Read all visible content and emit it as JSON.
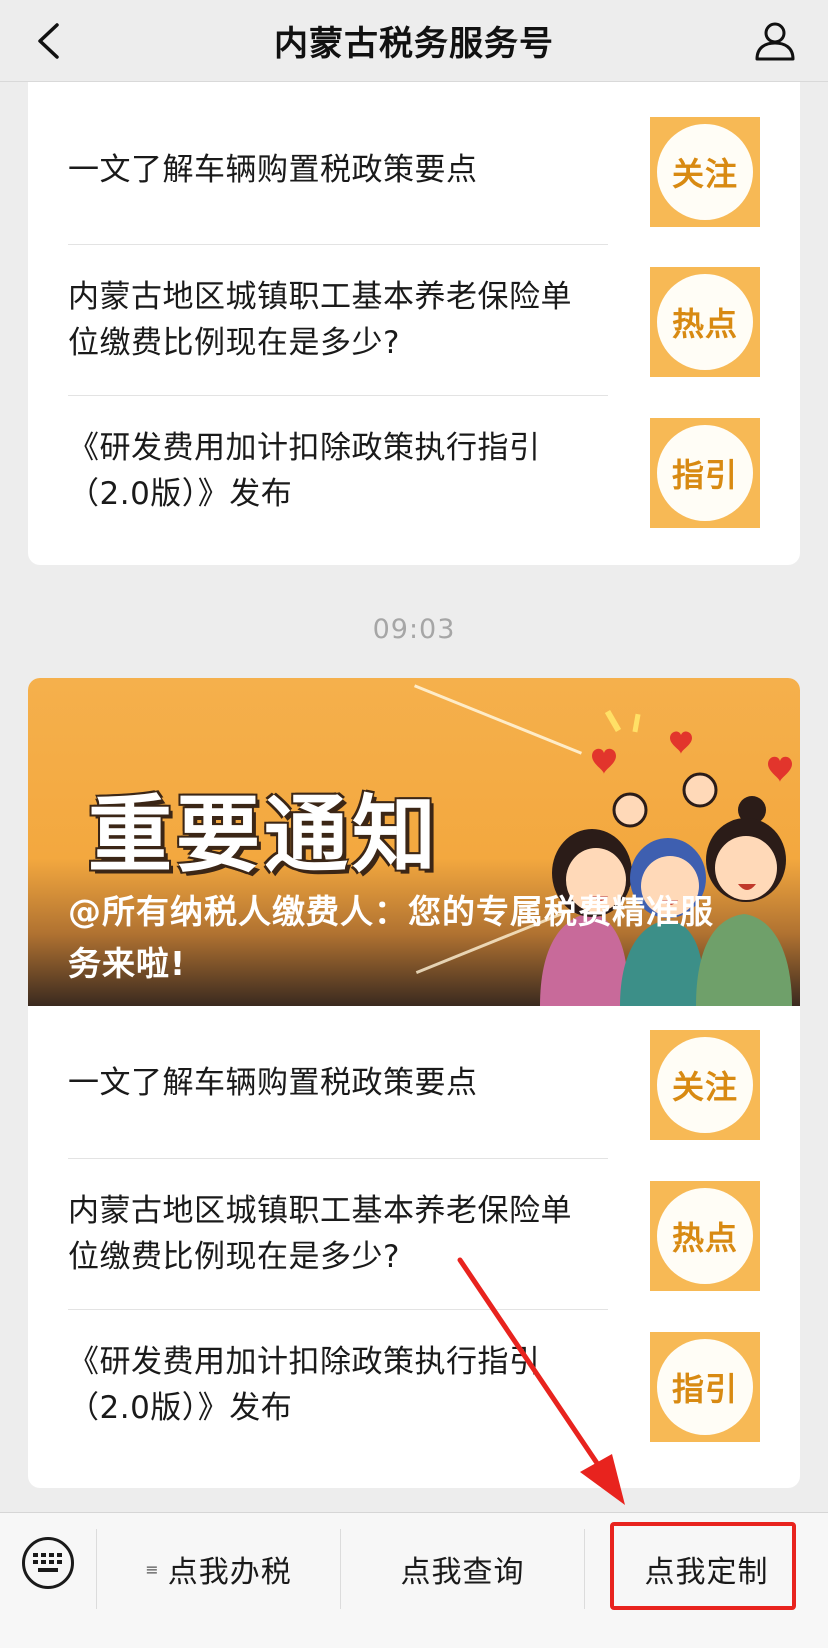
{
  "header": {
    "title": "内蒙古税务服务号",
    "back_icon": "chevron-left-icon",
    "user_icon": "user-icon"
  },
  "card1": {
    "items": [
      {
        "text": "一文了解车辆购置税政策要点",
        "badge": "关注"
      },
      {
        "text": "内蒙古地区城镇职工基本养老保险单位缴费比例现在是多少?",
        "badge": "热点"
      },
      {
        "text": "《研发费用加计扣除政策执行指引（2.0版）》发布",
        "badge": "指引"
      }
    ]
  },
  "timestamp": "09:03",
  "card2": {
    "banner": {
      "headline": "重要通知",
      "caption": "@所有纳税人缴费人：您的专属税费精准服务来啦!"
    },
    "items": [
      {
        "text": "一文了解车辆购置税政策要点",
        "badge": "关注"
      },
      {
        "text": "内蒙古地区城镇职工基本养老保险单位缴费比例现在是多少?",
        "badge": "热点"
      },
      {
        "text": "《研发费用加计扣除政策执行指引（2.0版）》发布",
        "badge": "指引"
      }
    ]
  },
  "bottom_menu": {
    "keyboard_icon": "keyboard-icon",
    "items": [
      {
        "label": "点我办税",
        "has_submenu": true,
        "submenu_icon": "≡"
      },
      {
        "label": "点我查询"
      },
      {
        "label": "点我定制"
      }
    ]
  },
  "colors": {
    "badge_bg": "#f7b955",
    "badge_text": "#d88a12",
    "annotation": "#e8231e"
  }
}
